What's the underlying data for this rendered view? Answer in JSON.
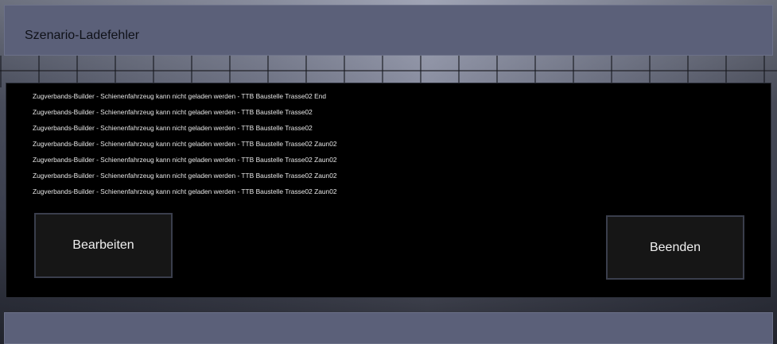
{
  "dialog": {
    "title": "Szenario-Ladefehler",
    "errors": [
      "Zugverbands-Builder - Schienenfahrzeug kann nicht geladen werden - TTB Baustelle Trasse02 End",
      "Zugverbands-Builder - Schienenfahrzeug kann nicht geladen werden - TTB Baustelle Trasse02",
      "Zugverbands-Builder - Schienenfahrzeug kann nicht geladen werden - TTB Baustelle Trasse02",
      "Zugverbands-Builder - Schienenfahrzeug kann nicht geladen werden - TTB Baustelle Trasse02 Zaun02",
      "Zugverbands-Builder - Schienenfahrzeug kann nicht geladen werden - TTB Baustelle Trasse02 Zaun02",
      "Zugverbands-Builder - Schienenfahrzeug kann nicht geladen werden - TTB Baustelle Trasse02 Zaun02",
      "Zugverbands-Builder - Schienenfahrzeug kann nicht geladen werden - TTB Baustelle Trasse02 Zaun02"
    ],
    "edit_label": "Bearbeiten",
    "quit_label": "Beenden"
  },
  "colors": {
    "header_bg": "#5b6079",
    "panel_bg": "#000000",
    "button_bg": "#161616",
    "button_border": "#3a3e4c"
  }
}
